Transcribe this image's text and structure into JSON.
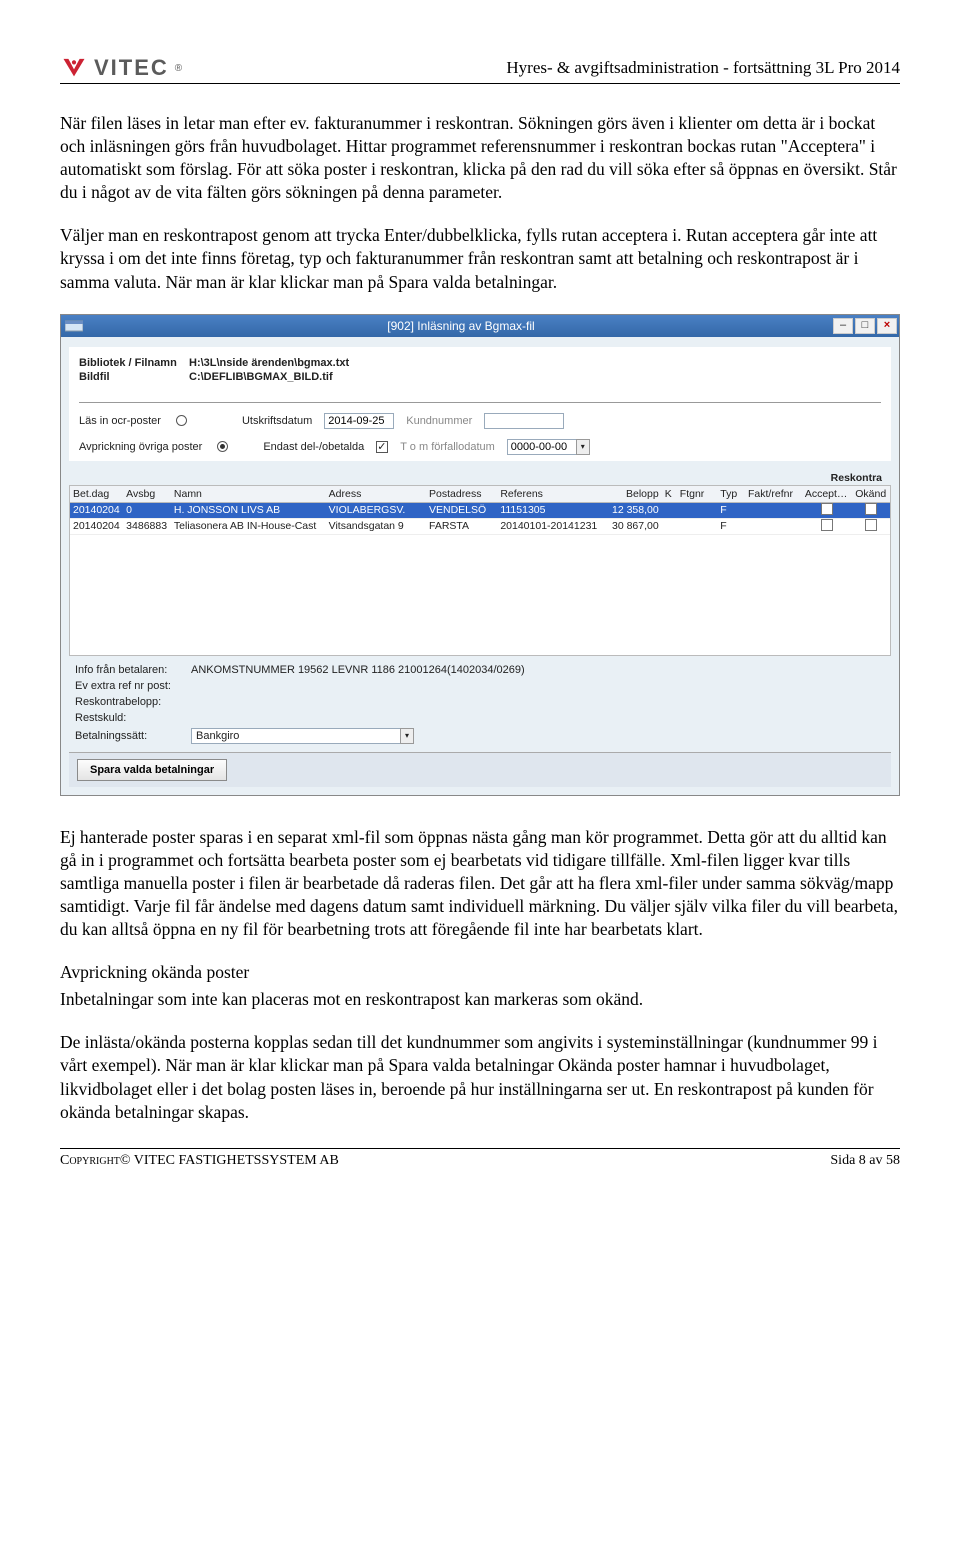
{
  "header": {
    "product_title": "Hyres- & avgiftsadministration - fortsättning 3L Pro 2014",
    "logo_text": "VITEC"
  },
  "paragraphs": {
    "p1": "När filen läses in letar man efter ev. fakturanummer i reskontran. Sökningen görs även i klienter om detta är i bockat och inläsningen görs från huvudbolaget. Hittar programmet referensnummer i reskontran bockas rutan \"Acceptera\" i automatiskt som förslag. För att söka poster i reskontran, klicka på den rad du vill söka efter så öppnas en översikt. Står du i något av de vita fälten görs sökningen på denna parameter.",
    "p2": "Väljer man en reskontrapost genom att trycka Enter/dubbelklicka, fylls rutan acceptera i. Rutan acceptera går inte att kryssa i om det inte finns företag, typ och fakturanummer från reskontran samt att betalning och reskontrapost är i samma valuta. När man är klar klickar man på Spara valda betalningar.",
    "p3": "Ej hanterade poster sparas i en separat xml-fil som öppnas nästa gång man kör programmet. Detta gör att du alltid kan gå in i programmet och fortsätta bearbeta poster som ej bearbetats vid tidigare tillfälle. Xml-filen ligger kvar tills samtliga manuella poster i filen är bearbetade då raderas filen. Det går att ha flera xml-filer under samma sökväg/mapp samtidigt. Varje fil får ändelse med dagens datum samt individuell märkning. Du väljer själv vilka filer du vill bearbeta, du kan alltså öppna en ny fil för bearbetning trots att föregående fil inte har bearbetats klart.",
    "sub_heading": "Avprickning okända poster",
    "p4": "Inbetalningar som inte kan placeras mot en reskontrapost kan markeras som okänd.",
    "p5": "De inlästa/okända posterna kopplas sedan till det kundnummer som angivits i systeminställningar (kundnummer 99 i vårt exempel). När man är klar klickar man på Spara valda betalningar Okända poster hamnar i huvudbolaget, likvidbolaget eller i det bolag posten läses in, beroende på hur inställningarna ser ut. En reskontrapost på kunden för okända betalningar skapas."
  },
  "window": {
    "title": "[902]  Inläsning av Bgmax-fil",
    "bibliotek_label": "Bibliotek / Filnamn",
    "bibliotek_value": "H:\\3L\\nside ärenden\\bgmax.txt",
    "bildfil_label": "Bildfil",
    "bildfil_value": "C:\\DEFLIB\\BGMAX_BILD.tif",
    "las_in_label": "Läs in ocr-poster",
    "utskriftsdatum_label": "Utskriftsdatum",
    "utskriftsdatum_value": "2014-09-25",
    "kundnummer_label": "Kundnummer",
    "kundnummer_value": "",
    "avprick_label": "Avprickning övriga poster",
    "endast_label": "Endast del-/obetalda",
    "tom_label": "T o m förfallodatum",
    "tom_value": "0000-00-00",
    "reskontra_group": "Reskontra",
    "columns": {
      "betdag": "Bet.dag",
      "avsbg": "Avsbg",
      "namn": "Namn",
      "adress": "Adress",
      "postadr": "Postadress",
      "ref": "Referens",
      "belopp": "Belopp",
      "k": "K",
      "ftgnr": "Ftgnr",
      "typ": "Typ",
      "fakt": "Fakt/refnr",
      "acc": "Acceptera",
      "okand": "Okänd"
    },
    "rows": [
      {
        "betdag": "20140204",
        "avsbg": "0",
        "namn": "H. JONSSON LIVS AB",
        "adress": "VIOLABERGSV.",
        "postadr": "VENDELSÖ",
        "ref": "11151305",
        "belopp": "12 358,00",
        "k": "",
        "ftgnr": "",
        "typ": "F",
        "fakt": ""
      },
      {
        "betdag": "20140204",
        "avsbg": "3486883",
        "namn": "Teliasonera AB IN-House-Cast",
        "adress": "Vitsandsgatan 9",
        "postadr": "FARSTA",
        "ref": "20140101-20141231",
        "belopp": "30 867,00",
        "k": "",
        "ftgnr": "",
        "typ": "F",
        "fakt": ""
      }
    ],
    "info_label": "Info från betalaren:",
    "info_value": "ANKOMSTNUMMER 19562 LEVNR 1186 21001264(1402034/0269)",
    "extraref_label": "Ev extra ref nr post:",
    "reskbelopp_label": "Reskontrabelopp:",
    "restskuld_label": "Restskuld:",
    "betsatt_label": "Betalningssätt:",
    "betsatt_value": "Bankgiro",
    "save_button": "Spara valda betalningar"
  },
  "footer": {
    "copyright": "Copyright© VITEC FASTIGHETSSYSTEM AB",
    "page": "Sida 8 av 58"
  }
}
